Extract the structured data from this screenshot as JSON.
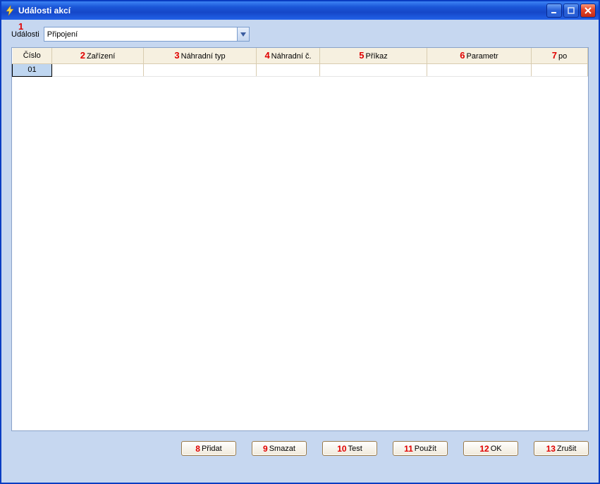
{
  "window": {
    "title": "Události akcí"
  },
  "top": {
    "annot": "1",
    "label": "Události",
    "selected": "Připojení"
  },
  "columns": [
    {
      "annot": "",
      "label": "Číslo"
    },
    {
      "annot": "2",
      "label": "Zařízení"
    },
    {
      "annot": "3",
      "label": "Náhradní typ"
    },
    {
      "annot": "4",
      "label": "Náhradní č."
    },
    {
      "annot": "5",
      "label": "Příkaz"
    },
    {
      "annot": "6",
      "label": "Parametr"
    },
    {
      "annot": "7",
      "label": "po"
    }
  ],
  "rows": [
    {
      "num": "01",
      "dev": "",
      "nt": "",
      "nc": "",
      "cmd": "",
      "par": "",
      "po": ""
    }
  ],
  "buttons": [
    {
      "annot": "8",
      "label": "Přidat",
      "name": "add-button"
    },
    {
      "annot": "9",
      "label": "Smazat",
      "name": "delete-button"
    },
    {
      "annot": "10",
      "label": "Test",
      "name": "test-button"
    },
    {
      "annot": "11",
      "label": "Použít",
      "name": "apply-button"
    },
    {
      "annot": "12",
      "label": "OK",
      "name": "ok-button"
    },
    {
      "annot": "13",
      "label": "Zrušit",
      "name": "cancel-button"
    }
  ]
}
